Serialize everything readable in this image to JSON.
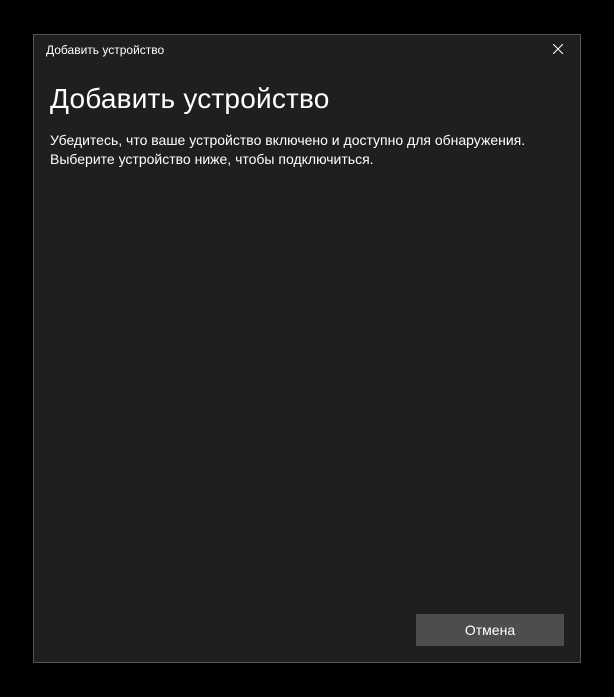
{
  "titlebar": {
    "title": "Добавить устройство"
  },
  "content": {
    "heading": "Добавить устройство",
    "description_line1": "Убедитесь, что ваше устройство включено и доступно для обнаружения.",
    "description_line2": "Выберите устройство ниже, чтобы подключиться."
  },
  "footer": {
    "cancel_label": "Отмена"
  }
}
